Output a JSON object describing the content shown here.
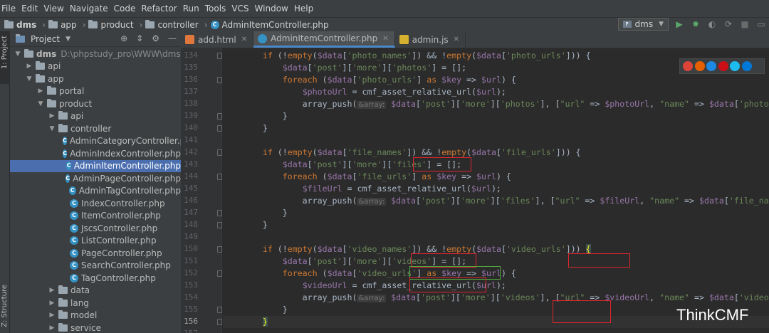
{
  "menu": [
    "File",
    "Edit",
    "View",
    "Navigate",
    "Code",
    "Refactor",
    "Run",
    "Tools",
    "VCS",
    "Window",
    "Help"
  ],
  "breadcrumb": [
    "dms",
    "app",
    "product",
    "controller",
    "AdminItemController.php"
  ],
  "run_config": "dms",
  "tool_windows": {
    "project": "1: Project",
    "structure": "Z: Structure"
  },
  "project_panel": {
    "title": "Project",
    "tree": [
      {
        "label": "dms",
        "hint": "D:\\phpstudy_pro\\WWW\\dms",
        "depth": 0,
        "kind": "folder",
        "expanded": true
      },
      {
        "label": "api",
        "depth": 1,
        "kind": "folder",
        "expanded": false
      },
      {
        "label": "app",
        "depth": 1,
        "kind": "folder",
        "expanded": true
      },
      {
        "label": "portal",
        "depth": 2,
        "kind": "folder",
        "expanded": false
      },
      {
        "label": "product",
        "depth": 2,
        "kind": "folder",
        "expanded": true
      },
      {
        "label": "api",
        "depth": 3,
        "kind": "folder",
        "expanded": false
      },
      {
        "label": "controller",
        "depth": 3,
        "kind": "folder",
        "expanded": true
      },
      {
        "label": "AdminCategoryController.p",
        "depth": 4,
        "kind": "php"
      },
      {
        "label": "AdminIndexController.php",
        "depth": 4,
        "kind": "php"
      },
      {
        "label": "AdminItemController.php",
        "depth": 4,
        "kind": "php",
        "selected": true
      },
      {
        "label": "AdminPageController.php",
        "depth": 4,
        "kind": "php"
      },
      {
        "label": "AdminTagController.php",
        "depth": 4,
        "kind": "php"
      },
      {
        "label": "IndexController.php",
        "depth": 4,
        "kind": "php"
      },
      {
        "label": "ItemController.php",
        "depth": 4,
        "kind": "php"
      },
      {
        "label": "JscsController.php",
        "depth": 4,
        "kind": "php"
      },
      {
        "label": "ListController.php",
        "depth": 4,
        "kind": "php"
      },
      {
        "label": "PageController.php",
        "depth": 4,
        "kind": "php"
      },
      {
        "label": "SearchController.php",
        "depth": 4,
        "kind": "php"
      },
      {
        "label": "TagController.php",
        "depth": 4,
        "kind": "php"
      },
      {
        "label": "data",
        "depth": 3,
        "kind": "folder",
        "expanded": false
      },
      {
        "label": "lang",
        "depth": 3,
        "kind": "folder",
        "expanded": false
      },
      {
        "label": "model",
        "depth": 3,
        "kind": "folder",
        "expanded": false
      },
      {
        "label": "service",
        "depth": 3,
        "kind": "folder",
        "expanded": false
      }
    ]
  },
  "tabs": [
    {
      "label": "add.html",
      "icon": "html-file-icon",
      "active": false
    },
    {
      "label": "AdminItemController.php",
      "icon": "php-file-icon",
      "active": true
    },
    {
      "label": "admin.js",
      "icon": "js-file-icon",
      "active": false
    }
  ],
  "code": {
    "current_line": 156,
    "lines": [
      {
        "n": 134,
        "fold": true,
        "tokens": [
          [
            "p",
            "        "
          ],
          [
            "kw",
            "if "
          ],
          [
            "p",
            "(!"
          ],
          [
            "kw",
            "empty"
          ],
          [
            "p",
            "("
          ],
          [
            "var",
            "$data"
          ],
          [
            "p",
            "["
          ],
          [
            "str",
            "'photo_names'"
          ],
          [
            "p",
            "]) && !"
          ],
          [
            "kw",
            "empty"
          ],
          [
            "p",
            "("
          ],
          [
            "var",
            "$data"
          ],
          [
            "p",
            "["
          ],
          [
            "str",
            "'photo_urls'"
          ],
          [
            "p",
            "])) {"
          ]
        ]
      },
      {
        "n": 135,
        "tokens": [
          [
            "p",
            "            "
          ],
          [
            "var",
            "$data"
          ],
          [
            "p",
            "["
          ],
          [
            "str",
            "'post'"
          ],
          [
            "p",
            "]["
          ],
          [
            "str",
            "'more'"
          ],
          [
            "p",
            "]["
          ],
          [
            "str",
            "'photos'"
          ],
          [
            "p",
            "] = [];"
          ]
        ]
      },
      {
        "n": 136,
        "fold": true,
        "tokens": [
          [
            "p",
            "            "
          ],
          [
            "kw",
            "foreach "
          ],
          [
            "p",
            "("
          ],
          [
            "var",
            "$data"
          ],
          [
            "p",
            "["
          ],
          [
            "str",
            "'photo_urls'"
          ],
          [
            "p",
            "] "
          ],
          [
            "kw",
            "as "
          ],
          [
            "var",
            "$key "
          ],
          [
            "p",
            "=> "
          ],
          [
            "var",
            "$url"
          ],
          [
            "p",
            ") {"
          ]
        ]
      },
      {
        "n": 137,
        "tokens": [
          [
            "p",
            "                "
          ],
          [
            "var",
            "$photoUrl "
          ],
          [
            "p",
            "= cmf_asset_relative_url("
          ],
          [
            "var",
            "$url"
          ],
          [
            "p",
            ");"
          ]
        ]
      },
      {
        "n": 138,
        "tokens": [
          [
            "p",
            "                array_push("
          ],
          [
            "hint",
            "&array:"
          ],
          [
            "p",
            " "
          ],
          [
            "var",
            "$data"
          ],
          [
            "p",
            "["
          ],
          [
            "str",
            "'post'"
          ],
          [
            "p",
            "]["
          ],
          [
            "str",
            "'more'"
          ],
          [
            "p",
            "]["
          ],
          [
            "str",
            "'photos'"
          ],
          [
            "p",
            "], ["
          ],
          [
            "str",
            "\"url\""
          ],
          [
            "p",
            " => "
          ],
          [
            "var",
            "$photoUrl"
          ],
          [
            "p",
            ", "
          ],
          [
            "str",
            "\"name\""
          ],
          [
            "p",
            " => "
          ],
          [
            "var",
            "$data"
          ],
          [
            "p",
            "["
          ],
          [
            "str",
            "'photo_names'"
          ]
        ]
      },
      {
        "n": 139,
        "fold": true,
        "tokens": [
          [
            "p",
            "            }"
          ]
        ]
      },
      {
        "n": 140,
        "fold": true,
        "tokens": [
          [
            "p",
            "        }"
          ]
        ]
      },
      {
        "n": 141,
        "tokens": []
      },
      {
        "n": 142,
        "fold": true,
        "tokens": [
          [
            "p",
            "        "
          ],
          [
            "kw",
            "if "
          ],
          [
            "p",
            "(!"
          ],
          [
            "kw",
            "empty"
          ],
          [
            "p",
            "("
          ],
          [
            "var",
            "$data"
          ],
          [
            "p",
            "["
          ],
          [
            "str",
            "'file_names'"
          ],
          [
            "p",
            "]) && !"
          ],
          [
            "kw",
            "empty"
          ],
          [
            "p",
            "("
          ],
          [
            "var",
            "$data"
          ],
          [
            "p",
            "["
          ],
          [
            "str",
            "'file_urls'"
          ],
          [
            "p",
            "])) {"
          ]
        ]
      },
      {
        "n": 143,
        "tokens": [
          [
            "p",
            "            "
          ],
          [
            "var",
            "$data"
          ],
          [
            "p",
            "["
          ],
          [
            "str",
            "'post'"
          ],
          [
            "p",
            "]["
          ],
          [
            "str",
            "'more'"
          ],
          [
            "p",
            "]["
          ],
          [
            "str",
            "'files'"
          ],
          [
            "p",
            "] = [];"
          ]
        ]
      },
      {
        "n": 144,
        "fold": true,
        "tokens": [
          [
            "p",
            "            "
          ],
          [
            "kw",
            "foreach "
          ],
          [
            "p",
            "("
          ],
          [
            "var",
            "$data"
          ],
          [
            "p",
            "["
          ],
          [
            "str",
            "'file_urls'"
          ],
          [
            "p",
            "] "
          ],
          [
            "kw",
            "as "
          ],
          [
            "var",
            "$key "
          ],
          [
            "p",
            "=> "
          ],
          [
            "var",
            "$url"
          ],
          [
            "p",
            ") {"
          ]
        ]
      },
      {
        "n": 145,
        "tokens": [
          [
            "p",
            "                "
          ],
          [
            "var",
            "$fileUrl "
          ],
          [
            "p",
            "= cmf_asset_relative_url("
          ],
          [
            "var",
            "$url"
          ],
          [
            "p",
            ");"
          ]
        ]
      },
      {
        "n": 146,
        "tokens": [
          [
            "p",
            "                array_push("
          ],
          [
            "hint",
            "&array:"
          ],
          [
            "p",
            " "
          ],
          [
            "var",
            "$data"
          ],
          [
            "p",
            "["
          ],
          [
            "str",
            "'post'"
          ],
          [
            "p",
            "]["
          ],
          [
            "str",
            "'more'"
          ],
          [
            "p",
            "]["
          ],
          [
            "str",
            "'files'"
          ],
          [
            "p",
            "], ["
          ],
          [
            "str",
            "\"url\""
          ],
          [
            "p",
            " => "
          ],
          [
            "var",
            "$fileUrl"
          ],
          [
            "p",
            ", "
          ],
          [
            "str",
            "\"name\""
          ],
          [
            "p",
            " => "
          ],
          [
            "var",
            "$data"
          ],
          [
            "p",
            "["
          ],
          [
            "str",
            "'file_names'"
          ]
        ]
      },
      {
        "n": 147,
        "fold": true,
        "tokens": [
          [
            "p",
            "            }"
          ]
        ]
      },
      {
        "n": 148,
        "fold": true,
        "tokens": [
          [
            "p",
            "        }"
          ]
        ]
      },
      {
        "n": 149,
        "tokens": []
      },
      {
        "n": 150,
        "fold": true,
        "tokens": [
          [
            "p",
            "        "
          ],
          [
            "kw",
            "if "
          ],
          [
            "p",
            "(!"
          ],
          [
            "kw",
            "empty"
          ],
          [
            "p",
            "("
          ],
          [
            "var",
            "$data"
          ],
          [
            "p",
            "["
          ],
          [
            "str",
            "'video_names'"
          ],
          [
            "p",
            "]) && !"
          ],
          [
            "kw",
            "empty"
          ],
          [
            "p",
            "("
          ],
          [
            "var",
            "$data"
          ],
          [
            "p",
            "["
          ],
          [
            "str",
            "'video_urls'"
          ],
          [
            "p",
            "])) "
          ],
          [
            "brace",
            "{"
          ]
        ]
      },
      {
        "n": 151,
        "tokens": [
          [
            "p",
            "            "
          ],
          [
            "var",
            "$data"
          ],
          [
            "p",
            "["
          ],
          [
            "str",
            "'post'"
          ],
          [
            "p",
            "]["
          ],
          [
            "str",
            "'more'"
          ],
          [
            "p",
            "]["
          ],
          [
            "str",
            "'videos'"
          ],
          [
            "p",
            "] = [];"
          ]
        ]
      },
      {
        "n": 152,
        "fold": true,
        "tokens": [
          [
            "p",
            "            "
          ],
          [
            "kw",
            "foreach "
          ],
          [
            "p",
            "("
          ],
          [
            "var",
            "$data"
          ],
          [
            "p",
            "["
          ],
          [
            "str",
            "'video_urls'"
          ],
          [
            "p",
            "] "
          ],
          [
            "kw",
            "as "
          ],
          [
            "var",
            "$key "
          ],
          [
            "p",
            "=> "
          ],
          [
            "var",
            "$url"
          ],
          [
            "p",
            ") {"
          ]
        ]
      },
      {
        "n": 153,
        "tokens": [
          [
            "p",
            "                "
          ],
          [
            "var",
            "$videoUrl "
          ],
          [
            "p",
            "= cmf_asset_relative_url("
          ],
          [
            "var",
            "$url"
          ],
          [
            "p",
            ");"
          ]
        ]
      },
      {
        "n": 154,
        "tokens": [
          [
            "p",
            "                array_push("
          ],
          [
            "hint",
            "&array:"
          ],
          [
            "p",
            " "
          ],
          [
            "var",
            "$data"
          ],
          [
            "p",
            "["
          ],
          [
            "str",
            "'post'"
          ],
          [
            "p",
            "]["
          ],
          [
            "str",
            "'more'"
          ],
          [
            "p",
            "]["
          ],
          [
            "str",
            "'videos'"
          ],
          [
            "p",
            "], ["
          ],
          [
            "str",
            "\"url\""
          ],
          [
            "p",
            " => "
          ],
          [
            "var",
            "$videoUrl"
          ],
          [
            "p",
            ", "
          ],
          [
            "str",
            "\"name\""
          ],
          [
            "p",
            " => "
          ],
          [
            "var",
            "$data"
          ],
          [
            "p",
            "["
          ],
          [
            "str",
            "'video_names'"
          ]
        ]
      },
      {
        "n": 155,
        "fold": true,
        "tokens": [
          [
            "p",
            "            }"
          ]
        ]
      },
      {
        "n": 156,
        "fold": true,
        "tokens": [
          [
            "p",
            "        "
          ],
          [
            "brace",
            "}"
          ]
        ]
      },
      {
        "n": 157,
        "tokens": []
      }
    ]
  },
  "browser_icons": [
    "chrome-icon",
    "firefox-icon",
    "safari-icon",
    "opera-icon",
    "ie-icon",
    "edge-icon"
  ],
  "watermark": "ThinkCMF",
  "colors": {
    "accent": "#4b6eaf",
    "annotation_red": "#e0252d",
    "annotation_green": "#4fa83d"
  }
}
